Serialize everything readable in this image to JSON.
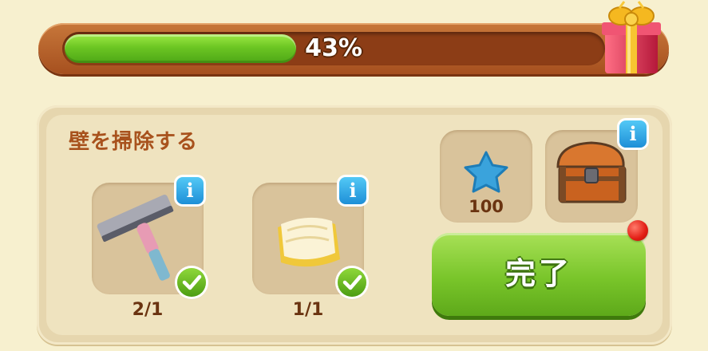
{
  "progress": {
    "percent_label": "43%",
    "fraction": 0.43
  },
  "task": {
    "title": "壁を掃除する",
    "items": [
      {
        "icon": "squeegee-icon",
        "count": "2/1",
        "completed": true
      },
      {
        "icon": "cleaning-cloth-icon",
        "count": "1/1",
        "completed": true
      }
    ]
  },
  "rewards": [
    {
      "icon": "blue-star-icon",
      "amount": "100"
    },
    {
      "icon": "treasure-chest-icon"
    }
  ],
  "complete_button": {
    "label": "完了"
  },
  "colors": {
    "progress_fill": "#6cc623",
    "title_text": "#a8521d",
    "button_green": "#79c52a",
    "info_blue": "#1e8fd7"
  }
}
